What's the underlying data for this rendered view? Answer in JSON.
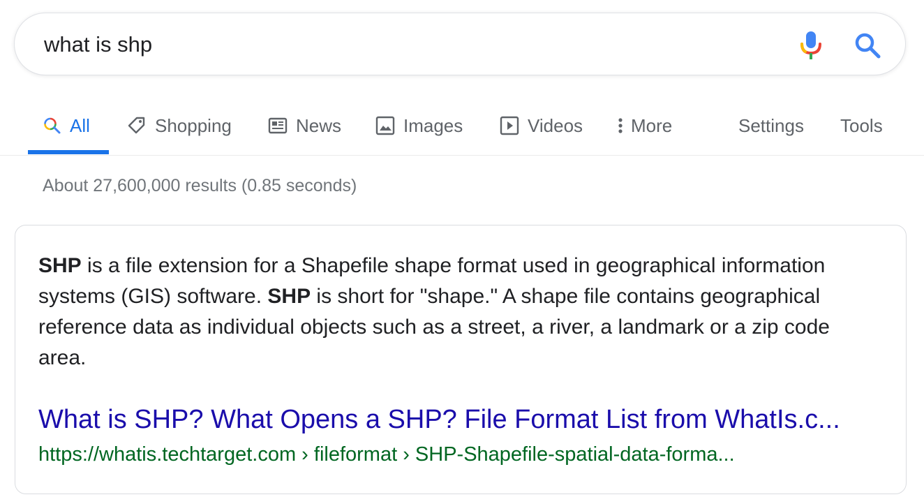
{
  "search": {
    "query": "what is shp"
  },
  "tabs": [
    {
      "label": "All",
      "icon": "search-multicolor-icon",
      "active": true
    },
    {
      "label": "Shopping",
      "icon": "tag-icon",
      "active": false
    },
    {
      "label": "News",
      "icon": "newspaper-icon",
      "active": false
    },
    {
      "label": "Images",
      "icon": "image-icon",
      "active": false
    },
    {
      "label": "Videos",
      "icon": "play-icon",
      "active": false
    },
    {
      "label": "More",
      "icon": "vertical-dots-icon",
      "active": false
    },
    {
      "label": "Settings",
      "active": false
    },
    {
      "label": "Tools",
      "active": false
    }
  ],
  "results": {
    "stats": "About 27,600,000 results (0.85 seconds)"
  },
  "featured_snippet": {
    "segments": [
      {
        "text": "SHP",
        "bold": true
      },
      {
        "text": " is a file extension for a Shapefile shape format used in geographical information systems (GIS) software. ",
        "bold": false
      },
      {
        "text": "SHP",
        "bold": true
      },
      {
        "text": " is short for \"shape.\" A shape file contains geographical reference data as individual objects such as a street, a river, a landmark or a zip code area.",
        "bold": false
      }
    ],
    "title": "What is SHP? What Opens a SHP? File Format List from WhatIs.c...",
    "url": "https://whatis.techtarget.com › fileformat › SHP-Shapefile-spatial-data-forma..."
  },
  "colors": {
    "accent": "#1a73e8",
    "link": "#1a0dab",
    "url_green": "#006621",
    "muted": "#5f6368"
  }
}
